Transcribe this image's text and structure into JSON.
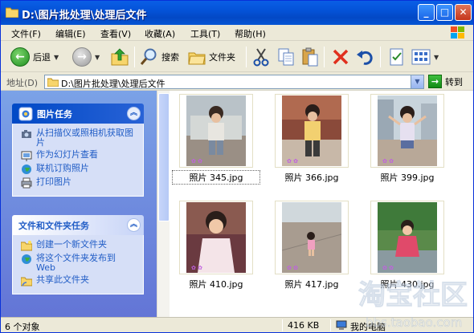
{
  "window": {
    "title": "D:\\图片批处理\\处理后文件"
  },
  "menu": [
    {
      "label": "文件(F)"
    },
    {
      "label": "编辑(E)"
    },
    {
      "label": "查看(V)"
    },
    {
      "label": "收藏(A)"
    },
    {
      "label": "工具(T)"
    },
    {
      "label": "帮助(H)"
    }
  ],
  "toolbar": {
    "back": "后退",
    "search": "搜索",
    "folders": "文件夹"
  },
  "address": {
    "label": "地址(D)",
    "value": "D:\\图片批处理\\处理后文件",
    "go": "转到"
  },
  "picture_tasks": {
    "title": "图片任务",
    "items": [
      "从扫描仪或照相机获取图片",
      "作为幻灯片查看",
      "联机订购照片",
      "打印图片"
    ]
  },
  "file_tasks": {
    "title": "文件和文件夹任务",
    "items": [
      "创建一个新文件夹",
      "将这个文件夹发布到 Web",
      "共享此文件夹"
    ]
  },
  "files": [
    {
      "name": "照片 345.jpg",
      "selected": true
    },
    {
      "name": "照片 366.jpg",
      "selected": false
    },
    {
      "name": "照片 399.jpg",
      "selected": false
    },
    {
      "name": "照片 410.jpg",
      "selected": false
    },
    {
      "name": "照片 417.jpg",
      "selected": false
    },
    {
      "name": "照片 430.jpg",
      "selected": false
    }
  ],
  "status": {
    "count": "6 个对象",
    "size": "416 KB",
    "location": "我的电脑"
  },
  "watermark": {
    "logo": "淘宝社区",
    "url": "bbs.taobao.com"
  },
  "colors": {
    "titlebar": "#0453d8",
    "taskpane": "#6f8fe0",
    "link": "#215dc6"
  }
}
